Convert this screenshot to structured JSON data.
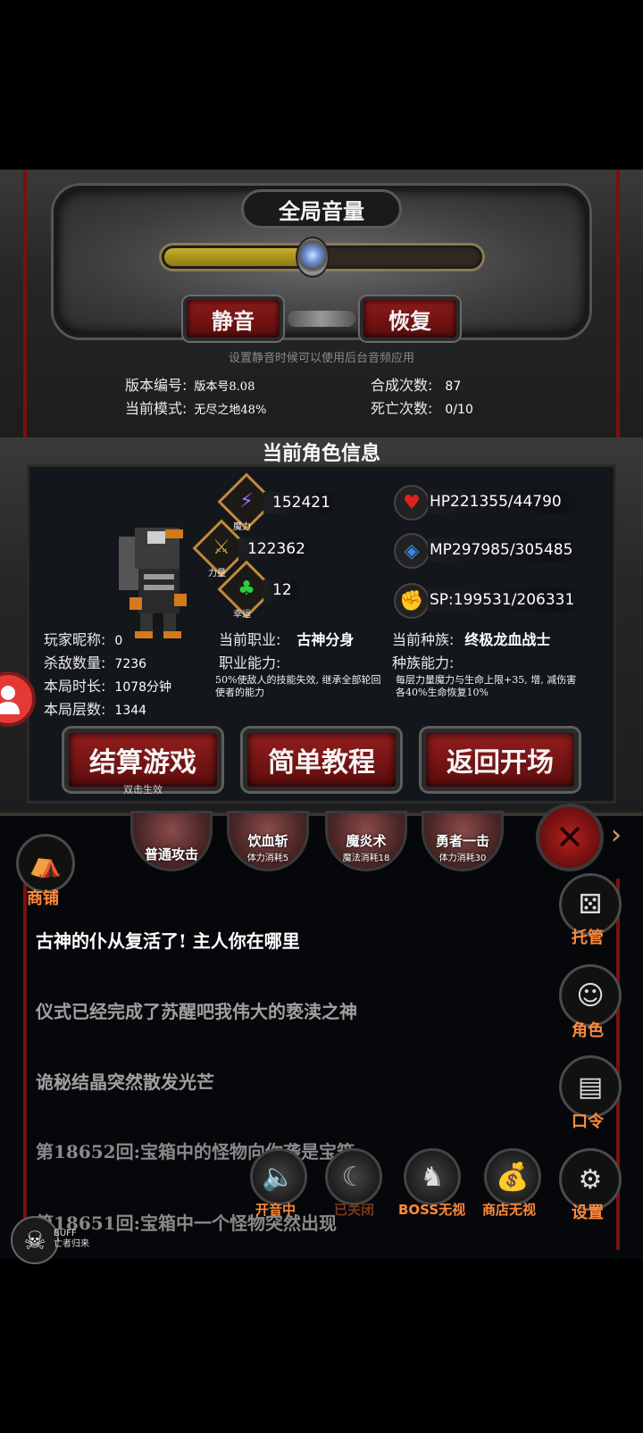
{
  "settings": {
    "volume_title": "全局音量",
    "volume_level": 0.47,
    "mute_label": "静音",
    "restore_label": "恢复",
    "hint": "设置静音时候可以使用后台音频应用",
    "version_label": "版本编号:",
    "version_value": "版本号8.08",
    "mode_label": "当前模式:",
    "mode_value": "无尽之地48%",
    "synth_label": "合成次数:",
    "synth_value": "87",
    "death_label": "死亡次数:",
    "death_value": "0/10"
  },
  "character": {
    "section_title": "当前角色信息",
    "magic_caption": "魔力",
    "magic_value": "152421",
    "strength_caption": "力量",
    "strength_value": "122362",
    "luck_caption": "幸运",
    "luck_value": "12",
    "hp_text": "HP221355/44790",
    "mp_text": "MP297985/305485",
    "sp_text": "SP:199531/206331",
    "nickname_label": "玩家昵称:",
    "nickname_value": "0",
    "kills_label": "杀敌数量:",
    "kills_value": "7236",
    "duration_label": "本局时长:",
    "duration_value": "1078分钟",
    "floors_label": "本局层数:",
    "floors_value": "1344",
    "job_label": "当前职业:",
    "job_value": "古神分身",
    "job_ability_label": "职业能力:",
    "job_ability_desc": "50%使敌人的技能失效, 继承全部轮回使者的能力",
    "race_label": "当前种族:",
    "race_value": "终极龙血战士",
    "race_ability_label": "种族能力:",
    "race_ability_desc": "每层力量魔力与生命上限+35, 增, 减伤害各40%生命恢复10%",
    "settle_button": "结算游戏",
    "settle_hint": "双击生效",
    "tutorial_button": "简单教程",
    "return_button": "返回开场"
  },
  "battle": {
    "skills": [
      {
        "name": "普通攻击",
        "cost": ""
      },
      {
        "name": "饮血斩",
        "cost": "体力消耗5"
      },
      {
        "name": "魔炎术",
        "cost": "魔法消耗18"
      },
      {
        "name": "勇者一击",
        "cost": "体力消耗30"
      }
    ],
    "shop_label": "商铺",
    "side_buttons": [
      "托管",
      "角色",
      "口令",
      "设置"
    ],
    "log": [
      {
        "text": "古神的仆从复活了! 主人你在哪里",
        "color": "#ffffff"
      },
      {
        "text": "仪式已经完成了苏醒吧我伟大的亵渎之神",
        "color": "#a0a0a0"
      },
      {
        "text": "诡秘结晶突然散发光芒",
        "color": "#a0a0a0"
      },
      {
        "text": "第18652回:宝箱中的怪物向你袭是宝箱",
        "color": "#8a8a8a"
      },
      {
        "text": "第18651回:宝箱中一个怪物突然出现",
        "color": "#8a8a8a"
      }
    ],
    "bottom_buttons": [
      "开音中",
      "已关闭",
      "BOSS无视",
      "商店无视"
    ],
    "buff_label": "BUFF",
    "buff_sub": "亡者归来"
  },
  "colors": {
    "accent_orange": "#ff8a3a",
    "button_red": "#8e1b1b",
    "slider_gold": "#c7ad2a"
  }
}
